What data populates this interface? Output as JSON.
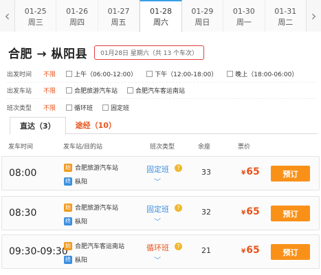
{
  "date_bar": {
    "prev_icon": "chevron-left",
    "next_icon": "chevron-right",
    "dates": [
      {
        "date": "01-25",
        "weekday": "周三"
      },
      {
        "date": "01-26",
        "weekday": "周四"
      },
      {
        "date": "01-27",
        "weekday": "周五"
      },
      {
        "date": "01-28",
        "weekday": "周六"
      },
      {
        "date": "01-29",
        "weekday": "周日"
      },
      {
        "date": "01-30",
        "weekday": "周一"
      },
      {
        "date": "01-31",
        "weekday": "周二"
      }
    ],
    "selected": "01-28"
  },
  "route": {
    "title": "合肥 → 枞阳县",
    "info": "01月28日 星期六（共 13 个车次）"
  },
  "filters": {
    "depart_time": {
      "label": "出发时间",
      "all": "不限",
      "options": [
        "上午（06:00-12:00）",
        "下午（12:00-18:00）",
        "晚上（18:00-06:00）"
      ]
    },
    "depart_station": {
      "label": "出发车站",
      "all": "不限",
      "options": [
        "合肥旅游汽车站",
        "合肥汽车客运南站"
      ]
    },
    "trip_type": {
      "label": "班次类型",
      "all": "不限",
      "options": [
        "循环班",
        "固定班"
      ]
    }
  },
  "tabs": {
    "direct": "直达（3）",
    "via": "途经（10）"
  },
  "table": {
    "headers": {
      "time": "发车时间",
      "station": "发车站/目的站",
      "type": "班次类型",
      "seats": "余座",
      "price": "票价"
    },
    "badge_from": "始",
    "badge_to": "终",
    "help": "?",
    "currency": "¥",
    "rows": [
      {
        "time": "08:00",
        "from": "合肥旅游汽车站",
        "to": "枞阳",
        "type": "固定班",
        "type_color": "#3b8fe0",
        "seats": "33",
        "price": "65",
        "book": "预订"
      },
      {
        "time": "08:30",
        "from": "合肥旅游汽车站",
        "to": "枞阳",
        "type": "固定班",
        "type_color": "#3b8fe0",
        "seats": "32",
        "price": "65",
        "book": "预订"
      },
      {
        "time": "09:30-09:30",
        "from": "合肥汽车客运南站",
        "to": "枞阳",
        "type": "循环班",
        "type_color": "#e8541c",
        "seats": "21",
        "price": "65",
        "book": "预订"
      }
    ]
  }
}
